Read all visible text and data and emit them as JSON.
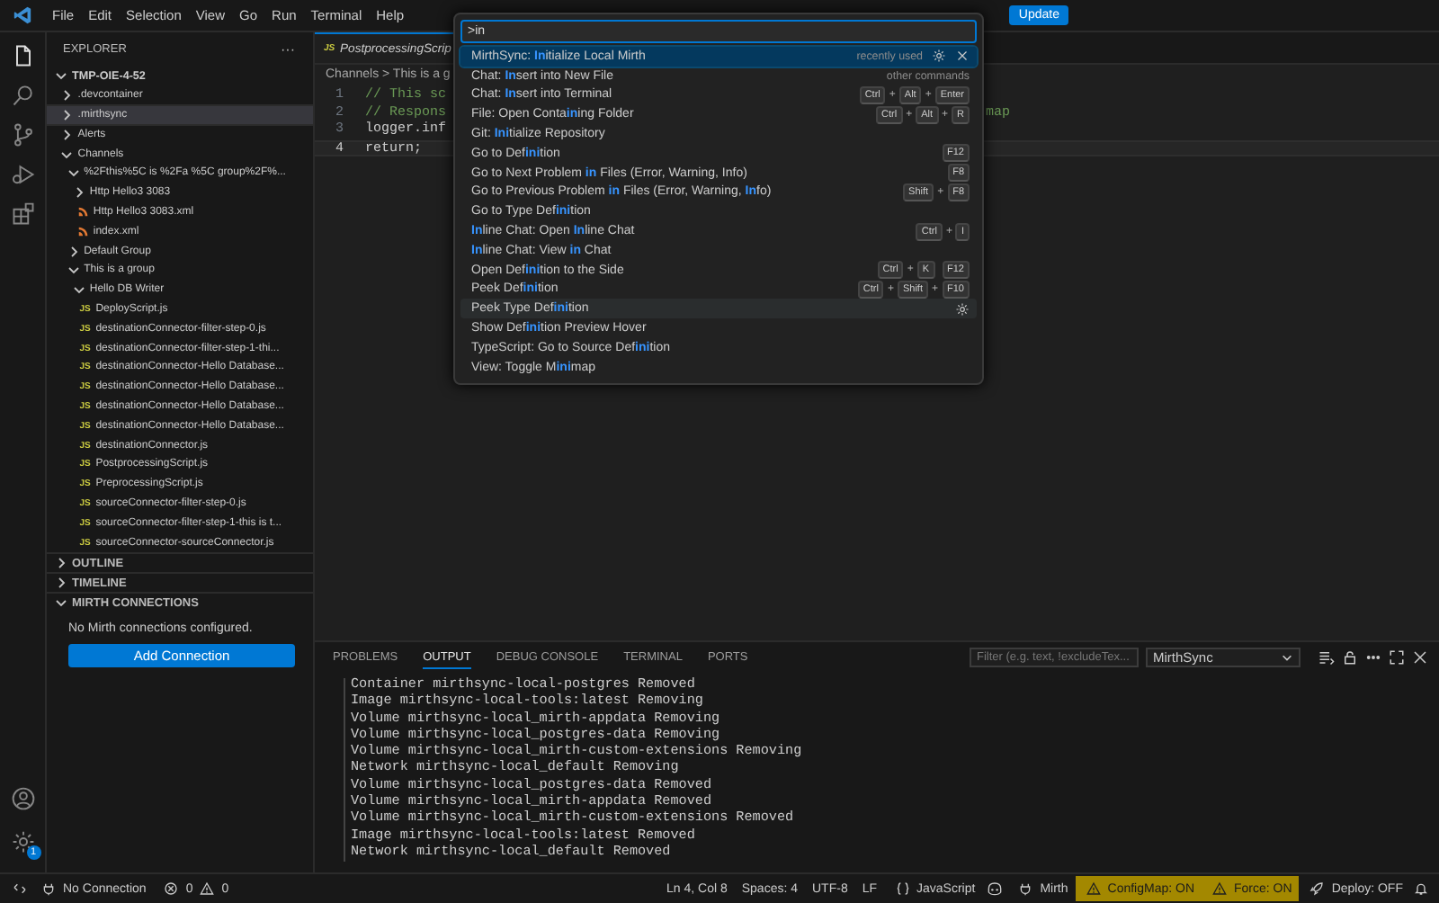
{
  "menu": [
    "File",
    "Edit",
    "Selection",
    "View",
    "Go",
    "Run",
    "Terminal",
    "Help"
  ],
  "update_button": "Update",
  "activity": {
    "top": [
      {
        "kind": "files",
        "selected": true
      },
      {
        "kind": "search",
        "selected": false
      },
      {
        "kind": "scm",
        "selected": false
      },
      {
        "kind": "debug",
        "selected": false
      },
      {
        "kind": "extensions",
        "selected": false
      }
    ],
    "bottom": [
      {
        "kind": "account"
      },
      {
        "kind": "settings",
        "badge": "1"
      }
    ]
  },
  "sidebar": {
    "title": "EXPLORER",
    "more": "···",
    "tree": [
      {
        "label": "TMP-OIE-4-52",
        "kind": "folder",
        "expanded": true,
        "selected": false,
        "children": [
          {
            "label": ".devcontainer",
            "kind": "folder",
            "expanded": false,
            "selected": false
          },
          {
            "label": ".mirthsync",
            "kind": "folder",
            "expanded": false,
            "selected": true
          },
          {
            "label": "Alerts",
            "kind": "folder",
            "expanded": false,
            "selected": false
          },
          {
            "label": "Channels",
            "kind": "folder",
            "expanded": true,
            "selected": false,
            "children": [
              {
                "label": "%2Fthis%5C is %2Fa %5C group%2F%...",
                "kind": "folder",
                "expanded": true,
                "selected": false,
                "children": [
                  {
                    "label": "Http Hello3 3083",
                    "kind": "folder",
                    "expanded": false,
                    "selected": false
                  },
                  {
                    "label": "Http Hello3 3083.xml",
                    "kind": "xml",
                    "selected": false
                  },
                  {
                    "label": "index.xml",
                    "kind": "xml",
                    "selected": false
                  }
                ]
              },
              {
                "label": "Default Group",
                "kind": "folder",
                "expanded": false,
                "selected": false
              },
              {
                "label": "This is a group",
                "kind": "folder",
                "expanded": true,
                "selected": false,
                "children": [
                  {
                    "label": "Hello DB Writer",
                    "kind": "folder",
                    "expanded": true,
                    "selected": false,
                    "children": [
                      {
                        "label": "DeployScript.js",
                        "kind": "js",
                        "badge": "JS",
                        "selected": false
                      },
                      {
                        "label": "destinationConnector-filter-step-0.js",
                        "kind": "js",
                        "badge": "JS",
                        "selected": false
                      },
                      {
                        "label": "destinationConnector-filter-step-1-thi...",
                        "kind": "js",
                        "badge": "JS",
                        "selected": false
                      },
                      {
                        "label": "destinationConnector-Hello Database...",
                        "kind": "js",
                        "badge": "JS",
                        "selected": false
                      },
                      {
                        "label": "destinationConnector-Hello Database...",
                        "kind": "js",
                        "badge": "JS",
                        "selected": false
                      },
                      {
                        "label": "destinationConnector-Hello Database...",
                        "kind": "js",
                        "badge": "JS",
                        "selected": false
                      },
                      {
                        "label": "destinationConnector-Hello Database...",
                        "kind": "js",
                        "badge": "JS",
                        "selected": false
                      },
                      {
                        "label": "destinationConnector.js",
                        "kind": "js",
                        "badge": "JS",
                        "selected": false
                      },
                      {
                        "label": "PostprocessingScript.js",
                        "kind": "js",
                        "badge": "JS",
                        "selected": false
                      },
                      {
                        "label": "PreprocessingScript.js",
                        "kind": "js",
                        "badge": "JS",
                        "selected": false
                      },
                      {
                        "label": "sourceConnector-filter-step-0.js",
                        "kind": "js",
                        "badge": "JS",
                        "selected": false
                      },
                      {
                        "label": "sourceConnector-filter-step-1-this is t...",
                        "kind": "js",
                        "badge": "JS",
                        "selected": false
                      },
                      {
                        "label": "sourceConnector-sourceConnector.js",
                        "kind": "js",
                        "badge": "JS",
                        "selected": false
                      }
                    ]
                  }
                ]
              }
            ]
          }
        ]
      }
    ],
    "sections": [
      {
        "title": "OUTLINE",
        "expanded": false
      },
      {
        "title": "TIMELINE",
        "expanded": false
      },
      {
        "title": "MIRTH CONNECTIONS",
        "expanded": true
      }
    ],
    "connections_message": "No Mirth connections configured.",
    "add_button": "Add Connection"
  },
  "editor": {
    "tab": {
      "badge": "JS",
      "label": "PostprocessingScrip"
    },
    "breadcrumb": "Channels > This is a g",
    "lines": [
      {
        "number": "1",
        "text": "// This sc"
      },
      {
        "number": "2",
        "text": "// Respons",
        "tail": "map"
      },
      {
        "number": "3",
        "text": "logger.inf"
      },
      {
        "number": "4",
        "text": "return;"
      }
    ]
  },
  "palette": {
    "value": ">in",
    "items": [
      {
        "label": "MirthSync: **In**itialize Local Mirth",
        "hint": "recently used",
        "selected": true,
        "hovered": false
      },
      {
        "label": "Chat: **In**sert into New File",
        "hint": "other commands",
        "selected": false,
        "hovered": false
      },
      {
        "label": "Chat: **In**sert into Terminal",
        "selected": false,
        "hovered": false,
        "keys": [
          {
            "keys": [
              "Ctrl",
              "Alt",
              "Enter"
            ],
            "joiner": "+"
          }
        ]
      },
      {
        "label": "File: Open Conta**in**ing Folder",
        "selected": false,
        "hovered": false,
        "keys": [
          {
            "keys": [
              "Ctrl",
              "Alt",
              "R"
            ],
            "joiner": "+"
          }
        ]
      },
      {
        "label": "Git: **Ini**tialize Repository",
        "selected": false,
        "hovered": false
      },
      {
        "label": "Go to Def**ini**tion",
        "selected": false,
        "hovered": false,
        "keys": [
          {
            "keys": [
              "F12"
            ]
          }
        ]
      },
      {
        "label": "Go to Next Problem **in** Files (Error, Warning, Info)",
        "selected": false,
        "hovered": false,
        "keys": [
          {
            "keys": [
              "F8"
            ]
          }
        ]
      },
      {
        "label": "Go to Previous Problem **in** Files (Error, Warning, **In**fo)",
        "selected": false,
        "hovered": false,
        "keys": [
          {
            "keys": [
              "Shift",
              "F8"
            ],
            "joiner": "+"
          }
        ]
      },
      {
        "label": "Go to Type Def**ini**tion",
        "selected": false,
        "hovered": false
      },
      {
        "label": "**In**line Chat: Open **In**line Chat",
        "selected": false,
        "hovered": false,
        "keys": [
          {
            "keys": [
              "Ctrl",
              "I"
            ],
            "joiner": "+"
          }
        ]
      },
      {
        "label": "**In**line Chat: View **in** Chat",
        "selected": false,
        "hovered": false
      },
      {
        "label": "Open Def**ini**tion to the Side",
        "selected": false,
        "hovered": false,
        "keys": [
          {
            "keys": [
              "Ctrl",
              "K"
            ],
            "joiner": "+"
          },
          {
            "keys": [
              "F12"
            ]
          }
        ]
      },
      {
        "label": "Peek Def**ini**tion",
        "selected": false,
        "hovered": false,
        "keys": [
          {
            "keys": [
              "Ctrl",
              "Shift",
              "F10"
            ],
            "joiner": "+"
          }
        ]
      },
      {
        "label": "Peek Type Def**ini**tion",
        "selected": false,
        "hovered": true
      },
      {
        "label": "Show Def**ini**tion Preview Hover",
        "selected": false,
        "hovered": false
      },
      {
        "label": "TypeScript: Go to Source Def**ini**tion",
        "selected": false,
        "hovered": false
      },
      {
        "label": "View: Toggle M**ini**map",
        "selected": false,
        "hovered": false
      }
    ]
  },
  "panel": {
    "tabs": [
      {
        "label": "PROBLEMS",
        "selected": false
      },
      {
        "label": "OUTPUT",
        "selected": true
      },
      {
        "label": "DEBUG CONSOLE",
        "selected": false
      },
      {
        "label": "TERMINAL",
        "selected": false
      },
      {
        "label": "PORTS",
        "selected": false
      }
    ],
    "filter": {
      "placeholder": "Filter (e.g. text, !excludeTex..."
    },
    "channel": "MirthSync",
    "lines": [
      "Container mirthsync-local-postgres Removed",
      "Image mirthsync-local-tools:latest Removing",
      "Volume mirthsync-local_mirth-appdata Removing",
      "Volume mirthsync-local_postgres-data Removing",
      "Volume mirthsync-local_mirth-custom-extensions Removing",
      "Network mirthsync-local_default Removing",
      "Volume mirthsync-local_postgres-data Removed",
      "Volume mirthsync-local_mirth-appdata Removed",
      "Volume mirthsync-local_mirth-custom-extensions Removed",
      "Image mirthsync-local-tools:latest Removed",
      "Network mirthsync-local_default Removed"
    ]
  },
  "status_bar": {
    "connection": "No Connection",
    "errors": "0",
    "warnings": "0",
    "right": [
      {
        "kind": "text",
        "text": "Ln 4, Col 8"
      },
      {
        "kind": "text",
        "text": "Spaces: 4"
      },
      {
        "kind": "text",
        "text": "UTF-8"
      },
      {
        "kind": "text",
        "text": "LF"
      },
      {
        "kind": "language",
        "text": "JavaScript"
      },
      {
        "kind": "copilot"
      },
      {
        "kind": "mirth",
        "text": "Mirth"
      },
      {
        "kind": "warning",
        "text": "ConfigMap: ON"
      },
      {
        "kind": "warning",
        "text": "Force: ON"
      },
      {
        "kind": "deploy",
        "text": "Deploy: OFF"
      },
      {
        "kind": "bell"
      }
    ]
  }
}
